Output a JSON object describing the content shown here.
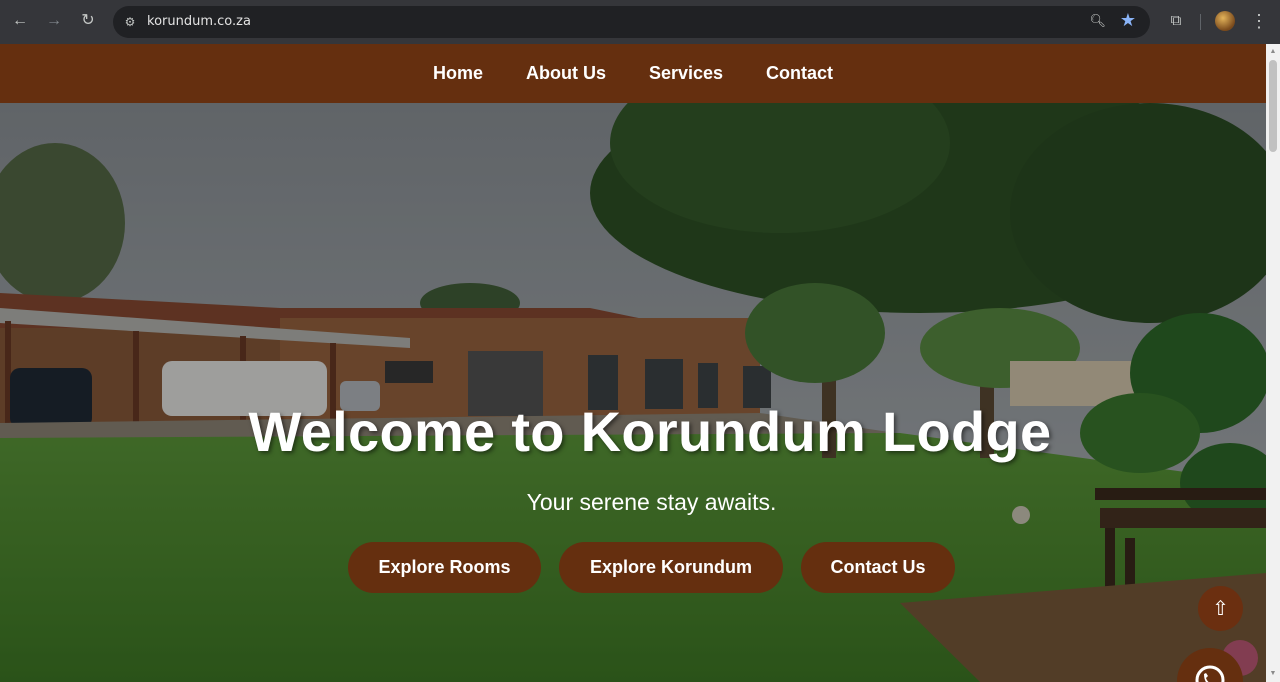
{
  "browser": {
    "url": "korundum.co.za",
    "back_icon": "arrow-left-icon",
    "forward_icon": "arrow-right-icon",
    "reload_icon": "reload-icon"
  },
  "nav": {
    "items": [
      {
        "label": "Home"
      },
      {
        "label": "About Us"
      },
      {
        "label": "Services"
      },
      {
        "label": "Contact"
      }
    ]
  },
  "hero": {
    "title": "Welcome to Korundum Lodge",
    "tagline": "Your serene stay awaits.",
    "buttons": [
      {
        "label": "Explore Rooms"
      },
      {
        "label": "Explore Korundum"
      },
      {
        "label": "Contact Us"
      }
    ]
  },
  "floating": {
    "to_top_glyph": "⇧"
  },
  "colors": {
    "brand_brown": "#652f0f",
    "chrome_bg": "#35363a"
  }
}
